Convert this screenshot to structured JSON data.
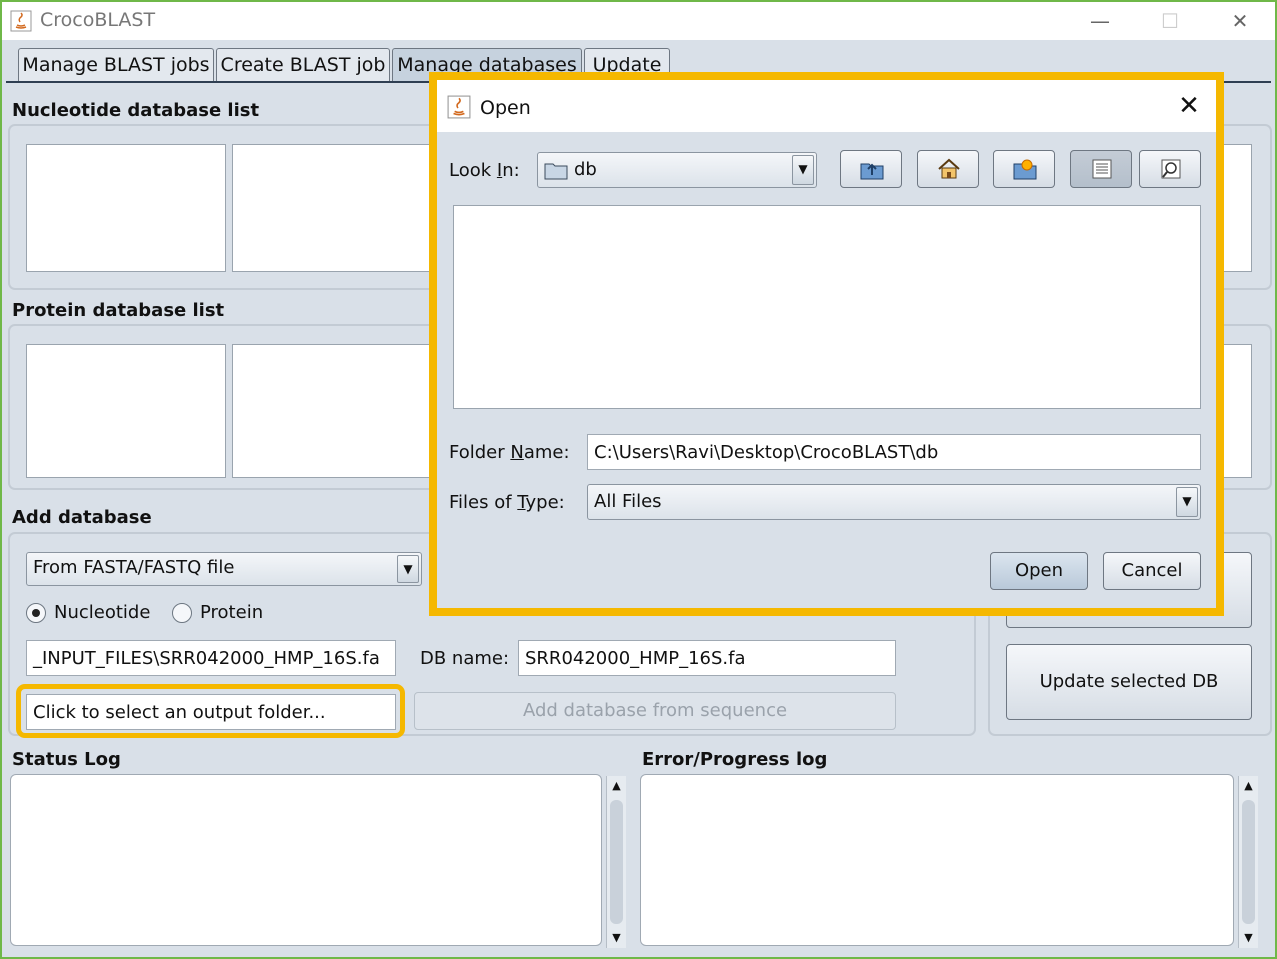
{
  "window": {
    "title": "CrocoBLAST"
  },
  "tabs": [
    {
      "label": "Manage BLAST jobs"
    },
    {
      "label": "Create BLAST job"
    },
    {
      "label": "Manage databases"
    },
    {
      "label": "Update"
    }
  ],
  "sections": {
    "nucleotide_title": "Nucleotide database list",
    "protein_title": "Protein database list",
    "add_title": "Add database",
    "status_title": "Status Log",
    "error_title": "Error/Progress log"
  },
  "add_database": {
    "source_selected": "From FASTA/FASTQ file",
    "radio_nucleotide": "Nucleotide",
    "radio_protein": "Protein",
    "selected_type": "Nucleotide",
    "input_file": "_INPUT_FILES\\SRR042000_HMP_16S.fa",
    "db_name_label": "DB name:",
    "db_name_value": "SRR042000_HMP_16S.fa",
    "output_folder_placeholder": "Click to select an output folder...",
    "add_from_sequence_button": "Add database from sequence"
  },
  "right_buttons": {
    "update_selected_db": "Update selected DB"
  },
  "dialog": {
    "title": "Open",
    "look_in_label_pre": "Look ",
    "look_in_label_u": "I",
    "look_in_label_post": "n:",
    "look_in_value": "db",
    "folder_name_label_pre": "Folder ",
    "folder_name_label_u": "N",
    "folder_name_label_post": "ame:",
    "folder_name_value": "C:\\Users\\Ravi\\Desktop\\CrocoBLAST\\db",
    "files_of_type_label_pre": "Files of ",
    "files_of_type_label_u": "T",
    "files_of_type_label_post": "ype:",
    "files_of_type_value": "All Files",
    "open_button": "Open",
    "cancel_button": "Cancel",
    "toolbar_icons": [
      "up-folder-icon",
      "home-icon",
      "new-folder-icon",
      "list-view-icon",
      "details-view-icon"
    ]
  },
  "colors": {
    "highlight": "#f5b800",
    "window_border": "#6fb848"
  }
}
